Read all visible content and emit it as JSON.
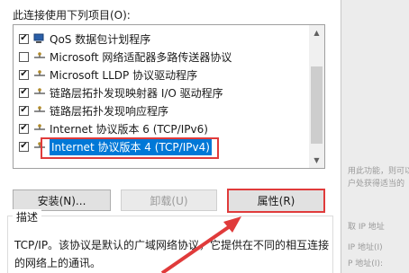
{
  "dialog": {
    "caption": "此连接使用下列项目(O):",
    "items": [
      {
        "checked": true,
        "icon": "qos-scheduler-icon",
        "label": "QoS 数据包计划程序"
      },
      {
        "checked": false,
        "icon": "network-protocol-icon",
        "label": "Microsoft 网络适配器多路传送器协议"
      },
      {
        "checked": true,
        "icon": "network-protocol-icon",
        "label": "Microsoft LLDP 协议驱动程序"
      },
      {
        "checked": true,
        "icon": "network-protocol-icon",
        "label": "链路层拓扑发现映射器 I/O 驱动程序"
      },
      {
        "checked": true,
        "icon": "network-protocol-icon",
        "label": "链路层拓扑发现响应程序"
      },
      {
        "checked": true,
        "icon": "network-protocol-icon",
        "label": "Internet 协议版本 6 (TCP/IPv6)"
      },
      {
        "checked": true,
        "icon": "network-protocol-icon",
        "label": "Internet 协议版本 4 (TCP/IPv4)",
        "selected": true
      }
    ],
    "check_mark": "✔",
    "buttons": {
      "install": "安装(N)...",
      "uninstall": "卸载(U)",
      "properties": "属性(R)"
    },
    "description": {
      "title": "描述",
      "text": "TCP/IP。该协议是默认的广域网络协议，它提供在不同的相互连接的网络上的通讯。"
    },
    "colors": {
      "selection": "#0078d7",
      "annotation": "#e03b3b"
    }
  },
  "background": {
    "lines": [
      "用此功能，则可以",
      "户处获得适当的",
      "取 IP 地址",
      "IP 地址(I)",
      "P 地址(I):"
    ]
  }
}
